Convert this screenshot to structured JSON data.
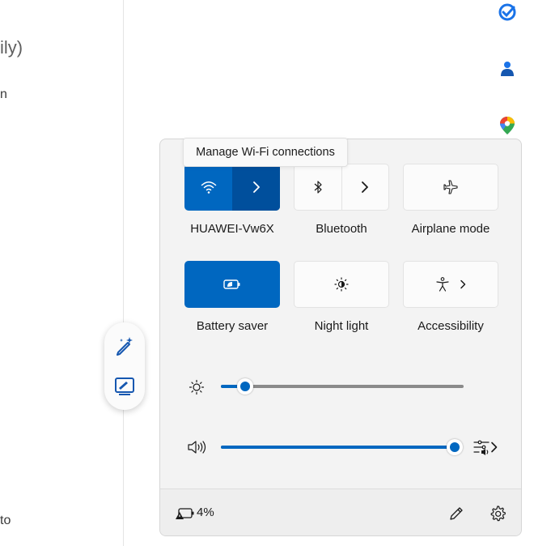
{
  "background": {
    "partial_text_1": "ily)",
    "partial_text_2": "n",
    "partial_text_3": "to"
  },
  "side_icons": [
    "todo-check-icon",
    "person-icon",
    "maps-pin-icon"
  ],
  "pen_toolbar": [
    "ai-pen-icon",
    "whiteboard-pen-icon"
  ],
  "tooltip": "Manage Wi-Fi connections",
  "tiles": {
    "wifi": {
      "label": "HUAWEI-Vw6X",
      "active": true
    },
    "bluetooth": {
      "label": "Bluetooth",
      "active": false
    },
    "airplane": {
      "label": "Airplane mode",
      "active": false
    },
    "battery_saver": {
      "label": "Battery saver",
      "active": true
    },
    "night_light": {
      "label": "Night light",
      "active": false
    },
    "accessibility": {
      "label": "Accessibility",
      "active": false
    }
  },
  "brightness": {
    "value_percent": 10
  },
  "volume": {
    "value_percent": 100
  },
  "footer": {
    "battery_percent": "4%"
  },
  "colors": {
    "accent": "#0067c0",
    "accent_dark": "#004f9c",
    "panel_bg": "#f3f3f3"
  }
}
